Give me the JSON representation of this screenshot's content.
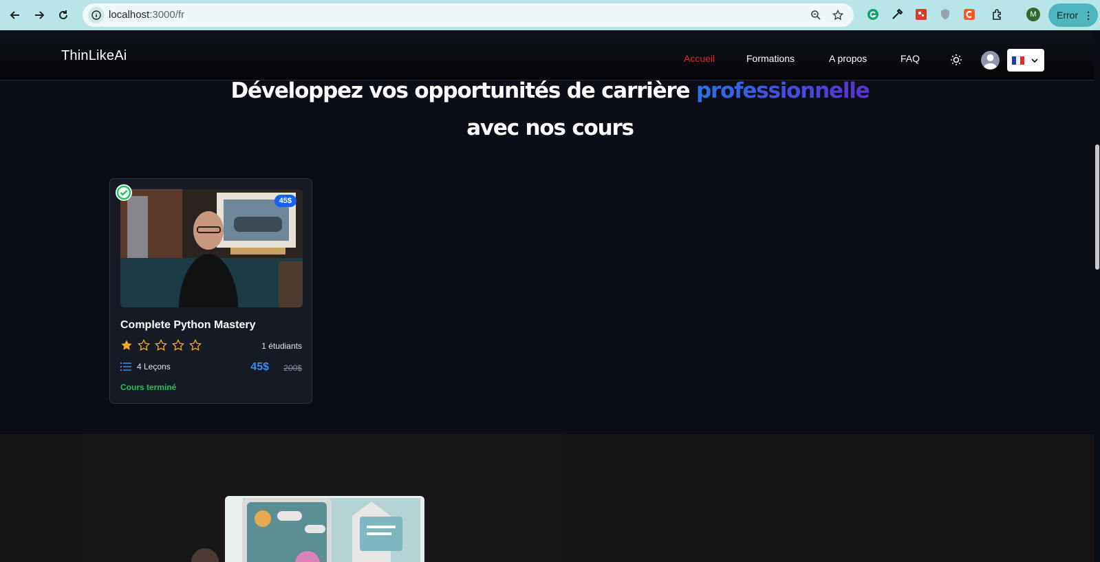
{
  "browser": {
    "url_host": "localhost",
    "url_path": ":3000/fr",
    "profile_initial": "M",
    "error_label": "Error"
  },
  "header": {
    "brand": "ThinLikeAi",
    "nav": [
      {
        "label": "Accueil",
        "active": true
      },
      {
        "label": "Formations",
        "active": false
      },
      {
        "label": "A propos",
        "active": false
      },
      {
        "label": "FAQ",
        "active": false
      }
    ],
    "language": "fr",
    "active_color": "#e3262e"
  },
  "hero": {
    "title_part1": "Développez vos opportunités de carrière",
    "title_highlight": "professionnelle",
    "title_line2": "avec nos cours"
  },
  "course_card": {
    "title": "Complete Python Mastery",
    "badge_price": "45$",
    "rating": 1,
    "rating_max": 5,
    "students": "1 étudiants",
    "lessons": "4 Leçons",
    "price": "45$",
    "old_price": "200$",
    "status": "Cours terminé",
    "completed": true,
    "status_color": "#25c25a",
    "price_color": "#3b8cf0"
  }
}
